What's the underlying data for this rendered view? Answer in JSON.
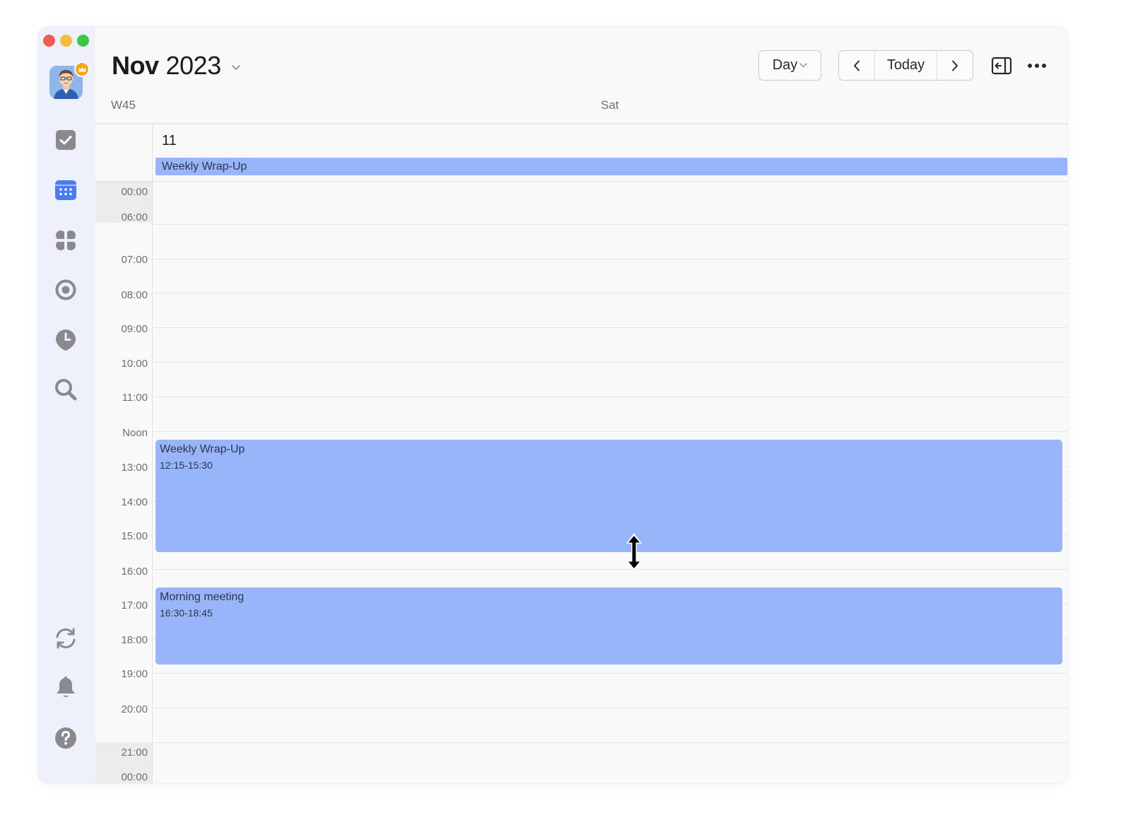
{
  "header": {
    "month": "Nov",
    "year": "2023",
    "view_mode": "Day",
    "today_label": "Today"
  },
  "day_header": {
    "week": "W45",
    "weekday": "Sat",
    "date": "11"
  },
  "all_day_event": {
    "title": "Weekly Wrap-Up"
  },
  "hours": [
    "00:00",
    "06:00",
    "07:00",
    "08:00",
    "09:00",
    "10:00",
    "11:00",
    "Noon",
    "13:00",
    "14:00",
    "15:00",
    "16:00",
    "17:00",
    "18:00",
    "19:00",
    "20:00",
    "21:00",
    "00:00"
  ],
  "events": [
    {
      "title": "Weekly Wrap-Up",
      "time": "12:15-15:30"
    },
    {
      "title": "Morning meeting",
      "time": "16:30-18:45"
    }
  ],
  "sidebar": {
    "items": [
      "tasks-icon",
      "calendar-icon",
      "apps-icon",
      "focus-icon",
      "timeline-icon",
      "search-icon",
      "sync-icon",
      "bell-icon",
      "help-icon"
    ]
  },
  "colors": {
    "event": "#98b5fa",
    "accent": "#4a7cf0",
    "sidebar": "#eef1fb"
  }
}
